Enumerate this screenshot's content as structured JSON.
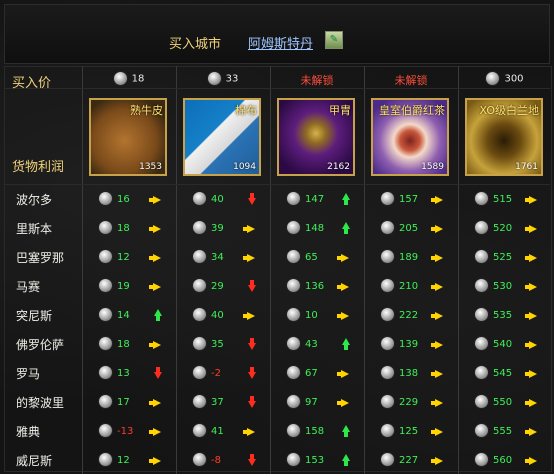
{
  "header": {
    "buy_city_label": "买入城市",
    "buy_city_value": "阿姆斯特丹"
  },
  "labels": {
    "buy_price": "买入价",
    "goods_profit": "货物利润"
  },
  "columns": [
    {
      "price": "18",
      "locked": false,
      "item": {
        "name": "熟牛皮",
        "qty": "1353",
        "icon": "leather-icon"
      }
    },
    {
      "price": "33",
      "locked": false,
      "item": {
        "name": "棉布",
        "qty": "1094",
        "icon": "cloth-icon"
      }
    },
    {
      "price": "未解锁",
      "locked": true,
      "item": {
        "name": "甲胄",
        "qty": "2162",
        "icon": "armor-icon"
      }
    },
    {
      "price": "未解锁",
      "locked": true,
      "item": {
        "name": "皇室伯爵红茶",
        "qty": "1589",
        "icon": "tea-cup-icon"
      }
    },
    {
      "price": "300",
      "locked": false,
      "item": {
        "name": "XO级白兰地",
        "qty": "1761",
        "icon": "brandy-icon"
      }
    }
  ],
  "rows": [
    {
      "city": "波尔多",
      "cells": [
        {
          "v": "16",
          "t": "right"
        },
        {
          "v": "40",
          "t": "down"
        },
        {
          "v": "147",
          "t": "up"
        },
        {
          "v": "157",
          "t": "right"
        },
        {
          "v": "515",
          "t": "right"
        }
      ]
    },
    {
      "city": "里斯本",
      "cells": [
        {
          "v": "18",
          "t": "right"
        },
        {
          "v": "39",
          "t": "right"
        },
        {
          "v": "148",
          "t": "up"
        },
        {
          "v": "205",
          "t": "right"
        },
        {
          "v": "520",
          "t": "right"
        }
      ]
    },
    {
      "city": "巴塞罗那",
      "cells": [
        {
          "v": "12",
          "t": "right"
        },
        {
          "v": "34",
          "t": "right"
        },
        {
          "v": "65",
          "t": "right"
        },
        {
          "v": "189",
          "t": "right"
        },
        {
          "v": "525",
          "t": "right"
        }
      ]
    },
    {
      "city": "马赛",
      "cells": [
        {
          "v": "19",
          "t": "right"
        },
        {
          "v": "29",
          "t": "down"
        },
        {
          "v": "136",
          "t": "right"
        },
        {
          "v": "210",
          "t": "right"
        },
        {
          "v": "530",
          "t": "right"
        }
      ]
    },
    {
      "city": "突尼斯",
      "cells": [
        {
          "v": "14",
          "t": "up"
        },
        {
          "v": "40",
          "t": "right"
        },
        {
          "v": "10",
          "t": "right"
        },
        {
          "v": "222",
          "t": "right"
        },
        {
          "v": "535",
          "t": "right"
        }
      ]
    },
    {
      "city": "佛罗伦萨",
      "cells": [
        {
          "v": "18",
          "t": "right"
        },
        {
          "v": "35",
          "t": "down"
        },
        {
          "v": "43",
          "t": "up"
        },
        {
          "v": "139",
          "t": "right"
        },
        {
          "v": "540",
          "t": "right"
        }
      ]
    },
    {
      "city": "罗马",
      "cells": [
        {
          "v": "13",
          "t": "down"
        },
        {
          "v": "-2",
          "t": "down"
        },
        {
          "v": "67",
          "t": "right"
        },
        {
          "v": "138",
          "t": "right"
        },
        {
          "v": "545",
          "t": "right"
        }
      ]
    },
    {
      "city": "的黎波里",
      "cells": [
        {
          "v": "17",
          "t": "right"
        },
        {
          "v": "37",
          "t": "down"
        },
        {
          "v": "97",
          "t": "right"
        },
        {
          "v": "229",
          "t": "right"
        },
        {
          "v": "550",
          "t": "right"
        }
      ]
    },
    {
      "city": "雅典",
      "cells": [
        {
          "v": "-13",
          "t": "right"
        },
        {
          "v": "41",
          "t": "right"
        },
        {
          "v": "158",
          "t": "up"
        },
        {
          "v": "125",
          "t": "right"
        },
        {
          "v": "555",
          "t": "right"
        }
      ]
    },
    {
      "city": "威尼斯",
      "cells": [
        {
          "v": "12",
          "t": "right"
        },
        {
          "v": "-8",
          "t": "down"
        },
        {
          "v": "153",
          "t": "up"
        },
        {
          "v": "227",
          "t": "right"
        },
        {
          "v": "560",
          "t": "right"
        }
      ]
    }
  ],
  "colors": {
    "gold_text": "#f0d27a",
    "profit_positive": "#3df058",
    "profit_negative": "#ff3b2c",
    "locked": "#ff4d3a",
    "trend_up": "#2ee84a",
    "trend_down": "#ff2d1f",
    "trend_flat": "#ffd400"
  }
}
